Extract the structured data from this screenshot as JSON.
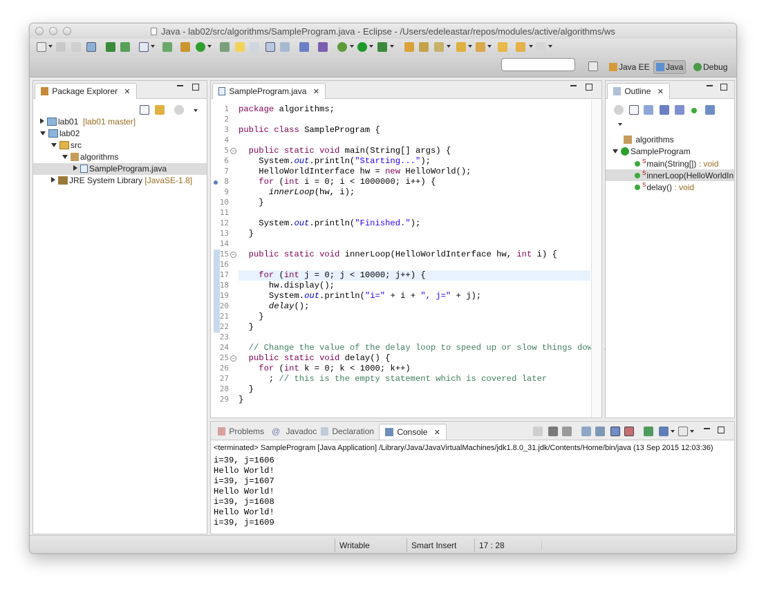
{
  "window": {
    "title": "Java - lab02/src/algorithms/SampleProgram.java - Eclipse - /Users/edeleastar/repos/modules/active/algorithms/ws"
  },
  "perspectives": [
    {
      "label": "Java EE",
      "active": false
    },
    {
      "label": "Java",
      "active": true
    },
    {
      "label": "Debug",
      "active": false
    }
  ],
  "package_explorer": {
    "tab_label": "Package Explorer",
    "tree": [
      {
        "label": "lab01",
        "decoration": "[lab01 master]",
        "indent": 0,
        "expanded": false
      },
      {
        "label": "lab02",
        "decoration": "",
        "indent": 0,
        "expanded": true
      },
      {
        "label": "src",
        "decoration": "",
        "indent": 1,
        "expanded": true
      },
      {
        "label": "algorithms",
        "decoration": "",
        "indent": 2,
        "expanded": true
      },
      {
        "label": "SampleProgram.java",
        "decoration": "",
        "indent": 3,
        "expanded": false,
        "selected": true
      },
      {
        "label": "JRE System Library",
        "decoration": "[JavaSE-1.8]",
        "indent": 1,
        "expanded": false
      }
    ]
  },
  "editor": {
    "tab_label": "SampleProgram.java",
    "current_line": 17,
    "lines": [
      "package algorithms;",
      "",
      "public class SampleProgram {",
      "",
      "  public static void main(String[] args) {",
      "    System.out.println(\"Starting...\");",
      "    HelloWorldInterface hw = new HelloWorld();",
      "    for (int i = 0; i < 1000000; i++) {",
      "      innerLoop(hw, i);",
      "    }",
      "",
      "    System.out.println(\"Finished.\");",
      "  }",
      "",
      "  public static void innerLoop(HelloWorldInterface hw, int i) {",
      "",
      "    for (int j = 0; j < 10000; j++) {",
      "      hw.display();",
      "      System.out.println(\"i=\" + i + \", j=\" + j);",
      "      delay();",
      "    }",
      "  }",
      "",
      "  // Change the value of the delay loop to speed up or slow things down .",
      "  public static void delay() {",
      "    for (int k = 0; k < 1000; k++)",
      "      ; // this is the empty statement which is covered later",
      "  }",
      "}"
    ]
  },
  "outline": {
    "tab_label": "Outline",
    "items": [
      {
        "label": "algorithms",
        "type": "",
        "kind": "package"
      },
      {
        "label": "SampleProgram",
        "type": "",
        "kind": "class"
      },
      {
        "label": "main(String[])",
        "type": " : void",
        "kind": "method"
      },
      {
        "label": "innerLoop(HelloWorldIn",
        "type": "",
        "kind": "method",
        "selected": true
      },
      {
        "label": "delay()",
        "type": " : void",
        "kind": "method"
      }
    ]
  },
  "bottom_tabs": [
    {
      "label": "Problems",
      "active": false
    },
    {
      "label": "Javadoc",
      "active": false
    },
    {
      "label": "Declaration",
      "active": false
    },
    {
      "label": "Console",
      "active": true
    }
  ],
  "console": {
    "terminated": "<terminated> SampleProgram [Java Application] /Library/Java/JavaVirtualMachines/jdk1.8.0_31.jdk/Contents/Home/bin/java (13 Sep 2015 12:03:36)",
    "lines": [
      "i=39, j=1606",
      "Hello World!",
      "i=39, j=1607",
      "Hello World!",
      "i=39, j=1608",
      "Hello World!",
      "i=39, j=1609"
    ]
  },
  "status": {
    "writable": "Writable",
    "insert_mode": "Smart Insert",
    "position": "17 : 28"
  }
}
